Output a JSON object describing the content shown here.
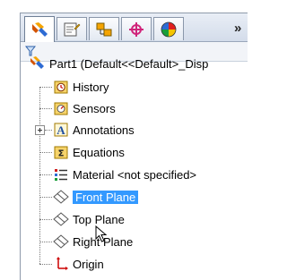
{
  "toolbar": {
    "tabs": [
      {
        "icon": "feature-manager-icon"
      },
      {
        "icon": "property-manager-icon"
      },
      {
        "icon": "configuration-manager-icon"
      },
      {
        "icon": "dimxpert-manager-icon"
      },
      {
        "icon": "display-manager-icon"
      }
    ],
    "more_label": "»"
  },
  "filter": {
    "icon": "filter-icon"
  },
  "tree": {
    "root_label": "Part1  (Default<<Default>_Disp",
    "items": [
      {
        "label": "History",
        "icon": "history-icon"
      },
      {
        "label": "Sensors",
        "icon": "sensors-icon"
      },
      {
        "label": "Annotations",
        "icon": "annotations-icon"
      },
      {
        "label": "Equations",
        "icon": "equations-icon"
      },
      {
        "label": "Material <not specified>",
        "icon": "material-icon"
      },
      {
        "label": "Front Plane",
        "icon": "plane-icon",
        "selected": true
      },
      {
        "label": "Top Plane",
        "icon": "plane-icon"
      },
      {
        "label": "Right Plane",
        "icon": "plane-icon"
      },
      {
        "label": "Origin",
        "icon": "origin-icon"
      }
    ]
  },
  "colors": {
    "selection": "#3399ff",
    "accent": "#f5a400"
  }
}
